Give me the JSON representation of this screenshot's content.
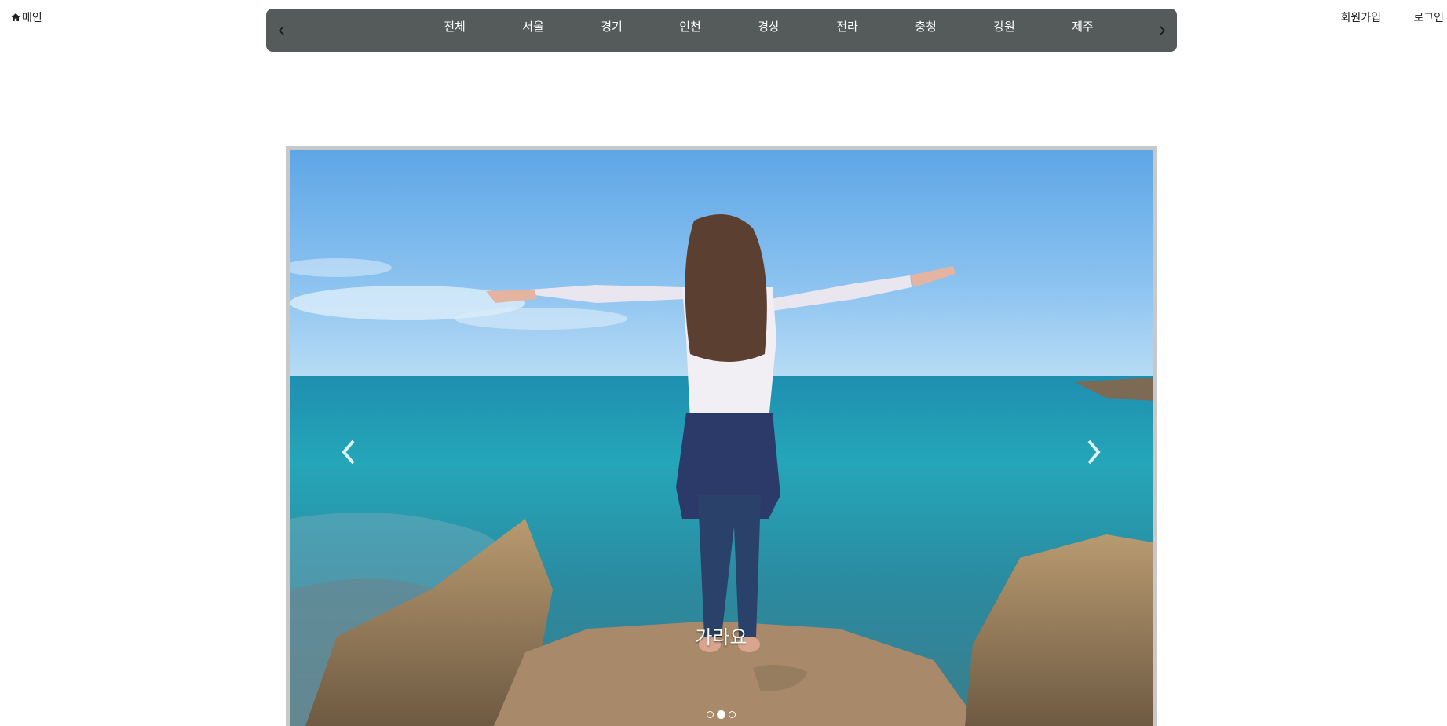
{
  "header": {
    "home_label": "메인",
    "signup_label": "회원가입",
    "login_label": "로그인"
  },
  "region_nav": {
    "items": [
      "전체",
      "서울",
      "경기",
      "인천",
      "경상",
      "전라",
      "충청",
      "강원",
      "제주"
    ],
    "background": "#555a5a"
  },
  "carousel": {
    "caption": "가라요",
    "slide_count": 3,
    "active_index": 1
  }
}
